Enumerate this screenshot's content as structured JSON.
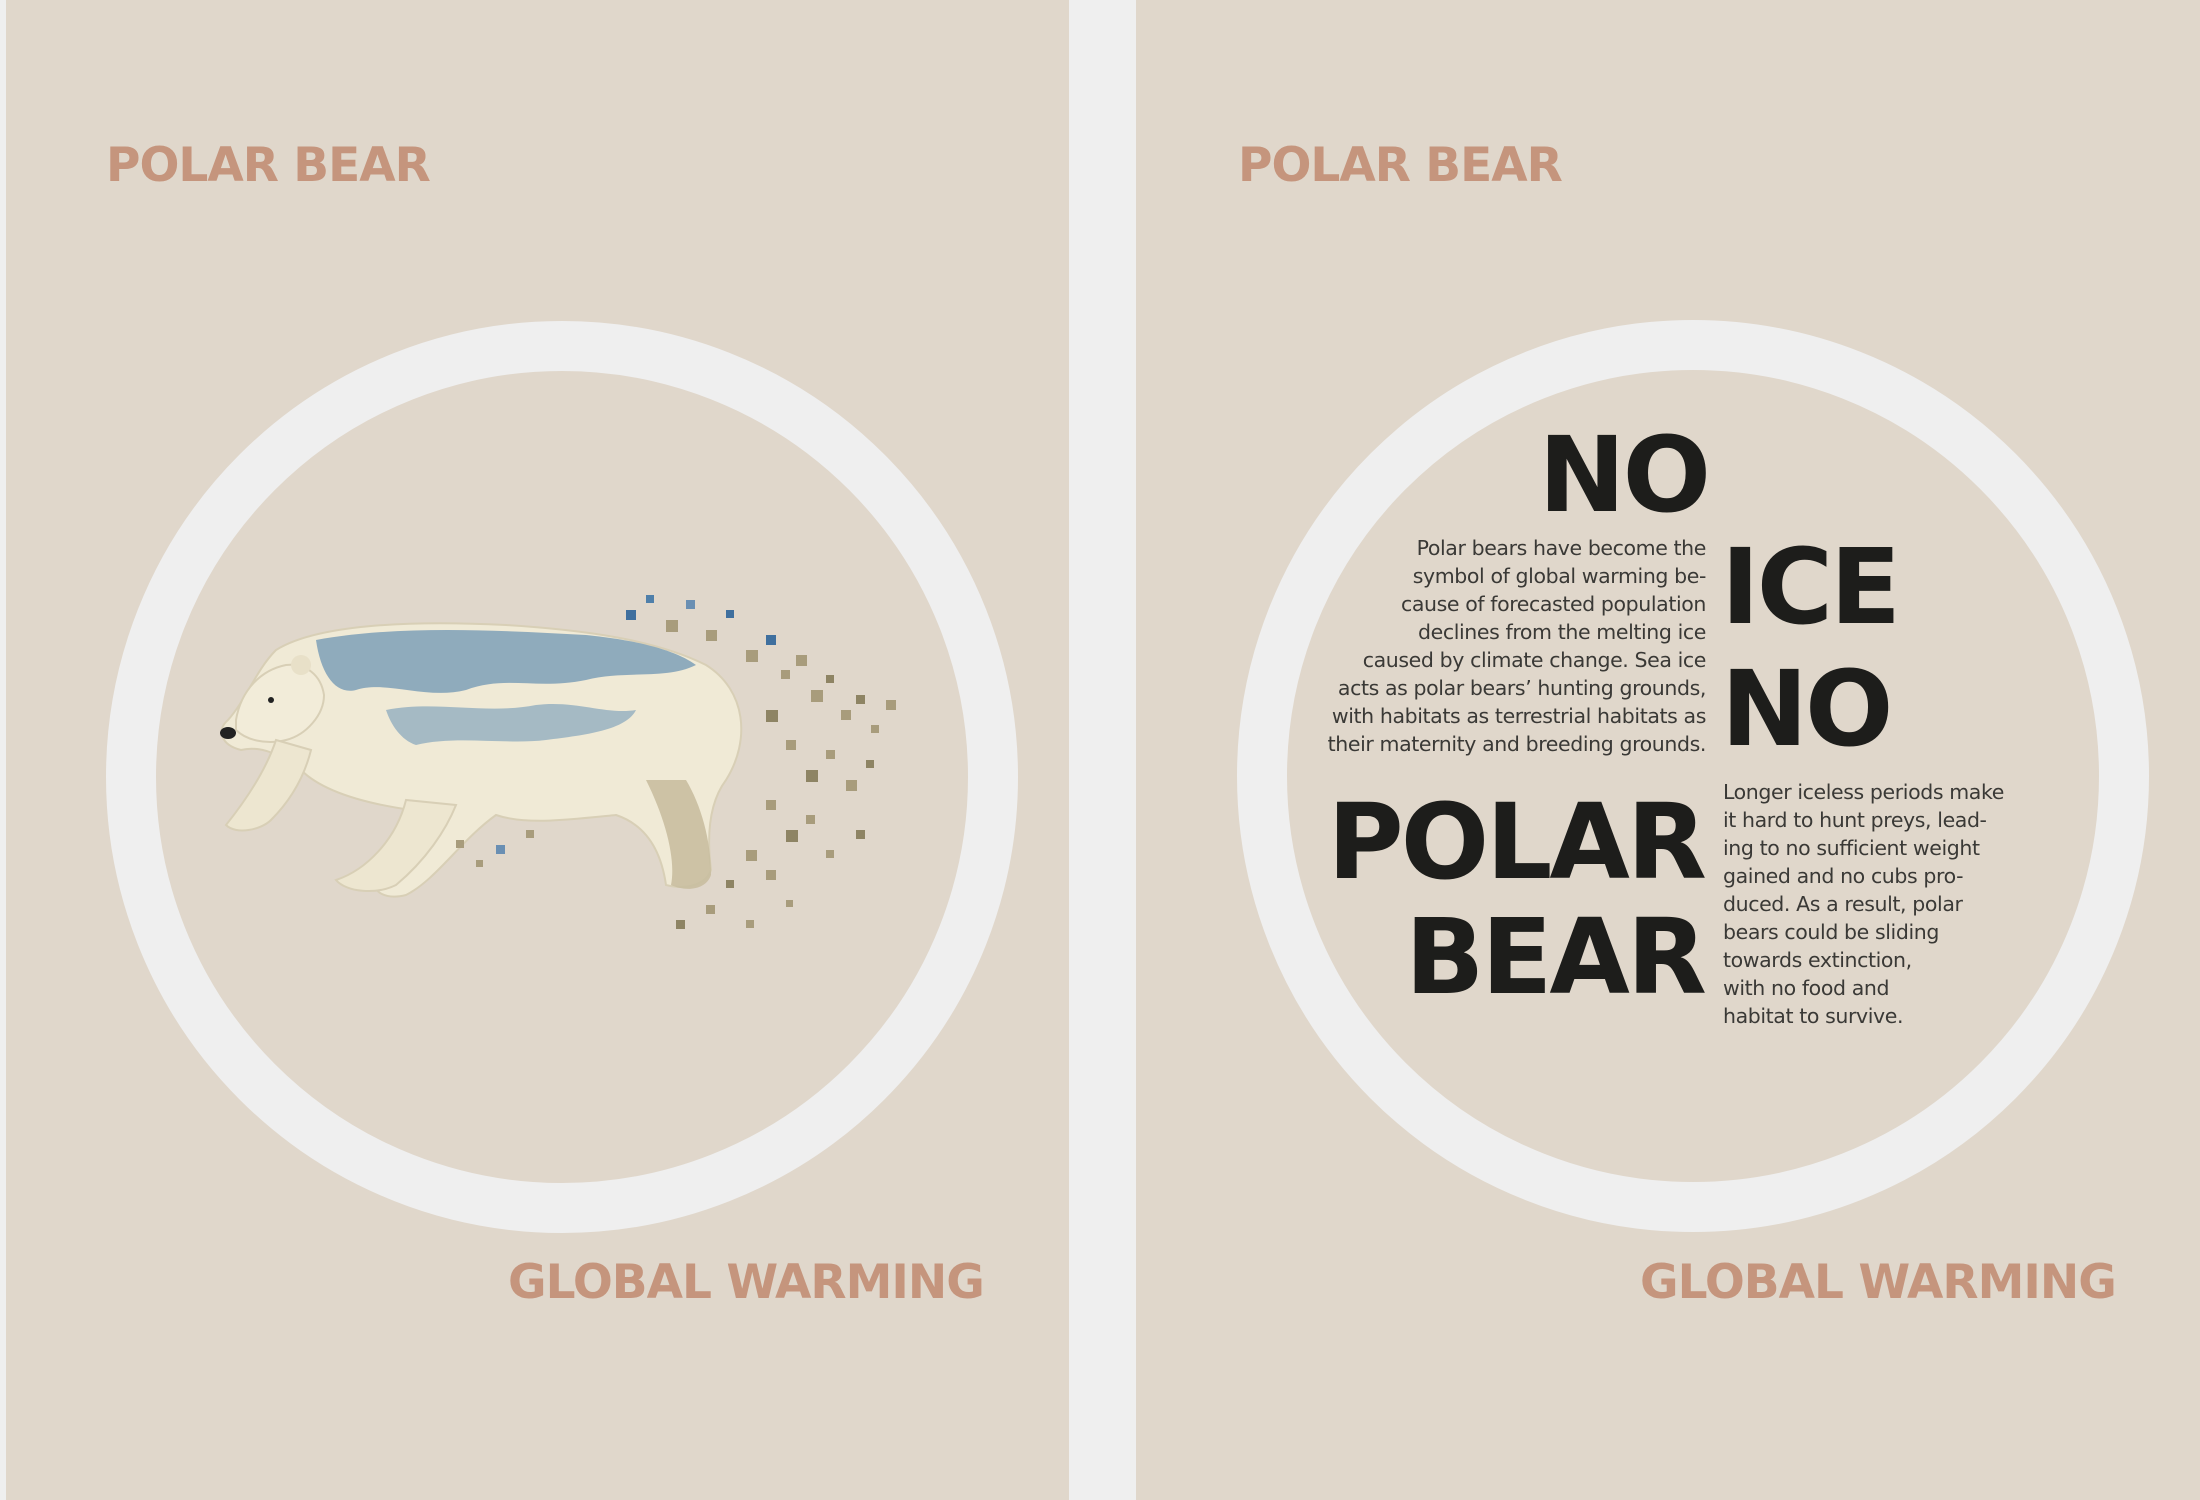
{
  "panels": {
    "left": {
      "header": "POLAR BEAR",
      "footer": "GLOBAL WARMING"
    },
    "right": {
      "header": "POLAR BEAR",
      "footer": "GLOBAL WARMING",
      "headline": {
        "word1": "NO",
        "word2": "ICE",
        "word3": "NO",
        "word4": "POLAR",
        "word5": "BEAR"
      },
      "paragraph_left": [
        "Polar bears have become the",
        "symbol of global warming be-",
        "cause of forecasted population",
        "declines from the melting ice",
        "caused by climate change. Sea ice",
        "acts as polar bears’ hunting grounds,",
        "with  habitats as terrestrial habitats as",
        "their maternity and breeding grounds."
      ],
      "paragraph_right": [
        "Longer iceless periods make",
        "it hard to hunt preys, lead-",
        "ing to no sufficient weight",
        "gained and no cubs pro-",
        "duced. As a result, polar",
        "bears could be sliding",
        "towards extinction,",
        "with no food and",
        "habitat to survive."
      ]
    }
  },
  "colors": {
    "panel_background": "#e0d7cb",
    "gutter": "#efefef",
    "accent_text": "#c5957d",
    "headline_text": "#1d1d1b",
    "ring": "#efefef"
  },
  "icons": {
    "bear_illustration": "polar-bear-dispersion-illustration"
  }
}
